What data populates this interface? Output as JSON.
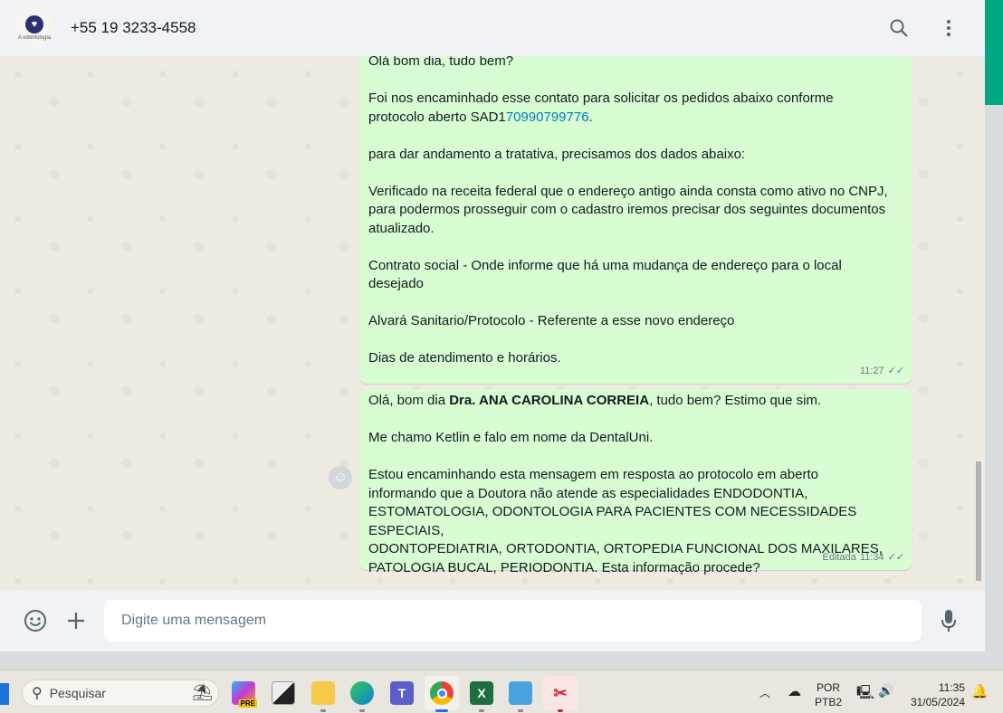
{
  "header": {
    "contact": "+55 19 3233-4558",
    "avatar_text": "A odontologia"
  },
  "messages": [
    {
      "lines": [
        "Olá bom dia, tudo bem?",
        "",
        "Foi nos encaminhado esse contato para solicitar os pedidos abaixo conforme",
        "protocolo aberto SAD1",
        "70990799776",
        ".",
        "",
        "para dar andamento a tratativa, precisamos dos dados abaixo:",
        "",
        "Verificado na receita federal que o endereço antigo ainda consta como ativo no CNPJ,",
        "para podermos prosseguir com o cadastro iremos precisar dos seguintes documentos",
        "atualizado.",
        "",
        "Contrato social - Onde informe que há uma mudança de endereço para o local",
        "desejado",
        "",
        "Alvará Sanitario/Protocolo - Referente a esse novo endereço",
        "",
        "Dias de atendimento e horários."
      ],
      "time": "11:27"
    },
    {
      "greeting_pre": "Olá, bom dia ",
      "name": "Dra. ANA CAROLINA CORREIA",
      "greeting_post": ", tudo bem? Estimo que sim.",
      "lines": [
        "Me chamo Ketlin e falo em nome da DentalUni.",
        "Estou encaminhando esta mensagem em resposta ao protocolo em aberto",
        "informando que a Doutora não atende as especialidades ENDODONTIA,",
        "ESTOMATOLOGIA, ODONTOLOGIA PARA PACIENTES COM NECESSIDADES ESPECIAIS,",
        "ODONTOPEDIATRIA, ORTODONTIA, ORTOPEDIA FUNCIONAL DOS MAXILARES,",
        "PATOLOGIA BUCAL, PERIODONTIA. Esta informação procede?"
      ],
      "edited": "Editada",
      "time": "11:34"
    }
  ],
  "footer": {
    "placeholder": "Digite uma mensagem"
  },
  "taskbar": {
    "search": "Pesquisar",
    "copilot_badge": "PRE",
    "lang1": "POR",
    "lang2": "PTB2",
    "time": "11:35",
    "date": "31/05/2024"
  }
}
